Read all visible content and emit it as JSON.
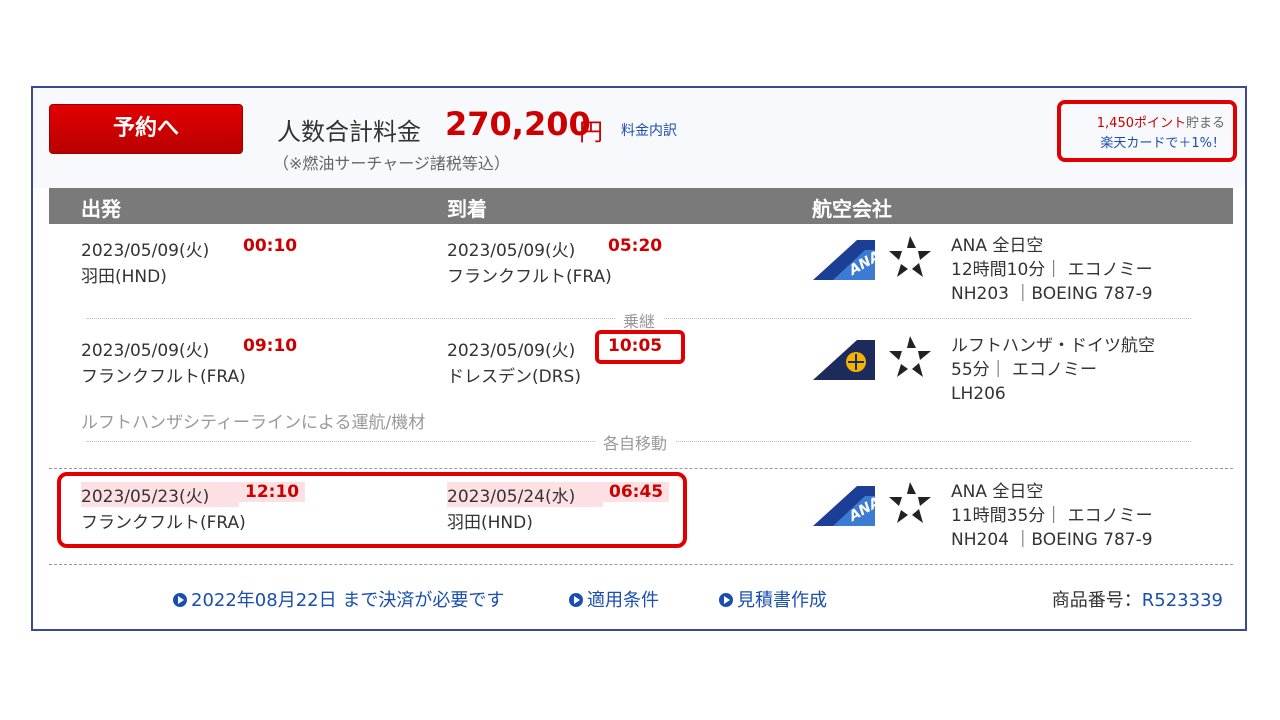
{
  "summary": {
    "reserve_button": "予約へ",
    "total_label": "人数合計料金",
    "total_price": "270,200",
    "currency": "円",
    "breakdown_link": "料金内訳",
    "tax_note": "（※燃油サーチャージ諸税等込）",
    "points_value": "1,450ポイント",
    "points_tail": "貯まる",
    "card_bonus": "楽天カードで＋1%！"
  },
  "columns": {
    "departure": "出発",
    "arrival": "到着",
    "airline": "航空会社"
  },
  "segments": [
    {
      "dep_date": "2023/05/09(火)",
      "dep_time": "00:10",
      "dep_place": "羽田(HND)",
      "arr_date": "2023/05/09(火)",
      "arr_time": "05:20",
      "arr_place": "フランクフルト(FRA)",
      "airline_name": "ANA 全日空",
      "duration_class": "12時間10分｜ エコノミー",
      "flight": "NH203 ｜BOEING 787-9",
      "logo": "ana-logo-icon"
    },
    {
      "dep_date": "2023/05/09(火)",
      "dep_time": "09:10",
      "dep_place": "フランクフルト(FRA)",
      "arr_date": "2023/05/09(火)",
      "arr_time": "10:05",
      "arr_place": "ドレスデン(DRS)",
      "airline_name": "ルフトハンザ・ドイツ航空",
      "duration_class": "55分｜ エコノミー",
      "flight": "LH206",
      "logo": "lufthansa-logo-icon"
    },
    {
      "dep_date": "2023/05/23(火)",
      "dep_time": "12:10",
      "dep_place": "フランクフルト(FRA)",
      "arr_date": "2023/05/24(水)",
      "arr_time": "06:45",
      "arr_place": "羽田(HND)",
      "airline_name": "ANA 全日空",
      "duration_class": "11時間35分｜ エコノミー",
      "flight": "NH204 ｜BOEING 787-9",
      "logo": "ana-logo-icon"
    }
  ],
  "transfer_label": "乗継",
  "operated_note": "ルフトハンザシティーラインによる運航/機材",
  "self_transfer_label": "各自移動",
  "footer": {
    "deadline": "2022年08月22日 まで決済が必要です",
    "conditions": "適用条件",
    "quote": "見積書作成",
    "product_label": "商品番号：",
    "product_code": "R523339"
  },
  "colors": {
    "accent_red": "#cc0000",
    "link_blue": "#1a4fb0",
    "header_gray": "#7a7a7a",
    "frame_navy": "#3a4a8a"
  }
}
